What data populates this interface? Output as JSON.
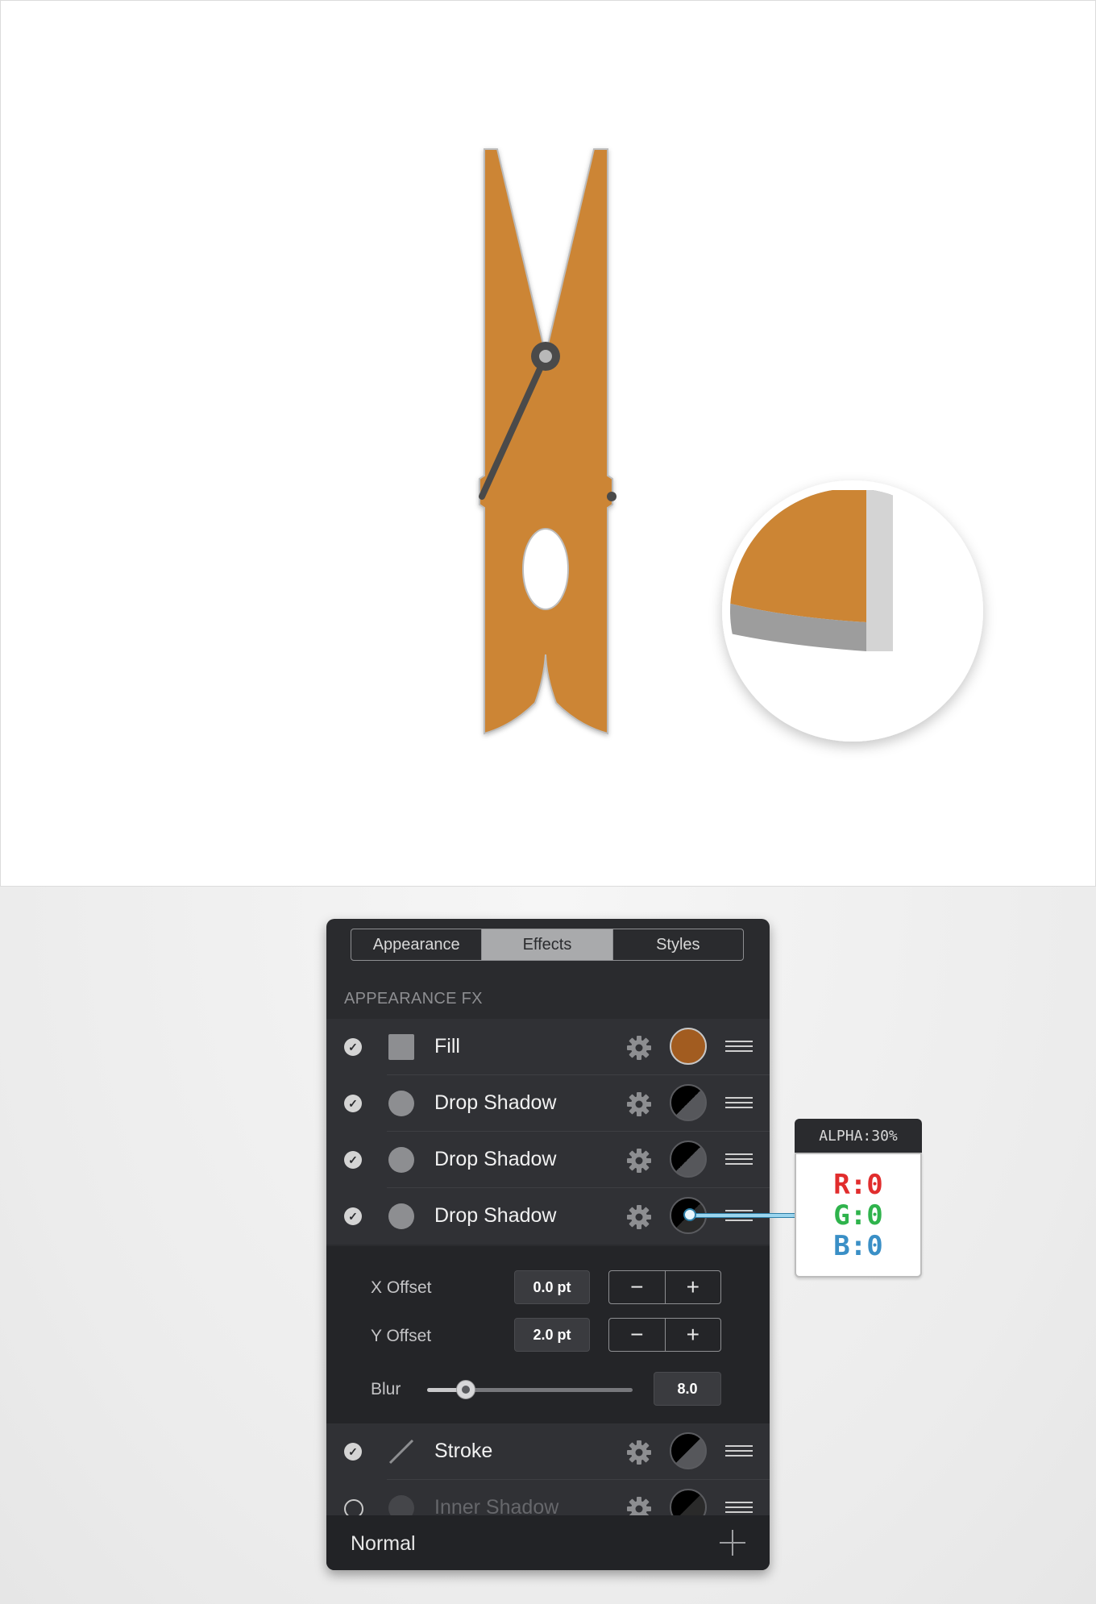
{
  "panel": {
    "tabs": [
      {
        "label": "Appearance",
        "active": false
      },
      {
        "label": "Effects",
        "active": true
      },
      {
        "label": "Styles",
        "active": false
      }
    ],
    "section_title": "APPEARANCE FX",
    "effects": [
      {
        "label": "Fill",
        "enabled": true,
        "icon": "fill-square-icon",
        "swatch": "#a25c20"
      },
      {
        "label": "Drop Shadow",
        "enabled": true,
        "icon": "shadow-circle-icon",
        "swatch": "half-black"
      },
      {
        "label": "Drop Shadow",
        "enabled": true,
        "icon": "shadow-circle-icon",
        "swatch": "half-black"
      },
      {
        "label": "Drop Shadow",
        "enabled": true,
        "icon": "shadow-circle-icon",
        "swatch": "half-black"
      }
    ],
    "settings": {
      "x_offset_label": "X Offset",
      "x_offset_value": "0.0 pt",
      "y_offset_label": "Y Offset",
      "y_offset_value": "2.0 pt",
      "blur_label": "Blur",
      "blur_value": "8.0",
      "blur_slider_fraction": 0.19,
      "minus": "−",
      "plus": "+"
    },
    "effects_after": [
      {
        "label": "Stroke",
        "enabled": true,
        "icon": "stroke-line-icon",
        "swatch": "half-black"
      },
      {
        "label": "Inner Shadow",
        "enabled": false,
        "icon": "inner-shadow-circle-icon",
        "swatch": "half-black"
      }
    ],
    "footer": {
      "blend_mode": "Normal"
    }
  },
  "callout": {
    "alpha": "ALPHA:30%",
    "r": "R:0",
    "g": "G:0",
    "b": "B:0"
  },
  "colors": {
    "clothespin": "#cc8534",
    "fill_swatch": "#a25c20",
    "panel_bg": "#2a2b2e"
  }
}
